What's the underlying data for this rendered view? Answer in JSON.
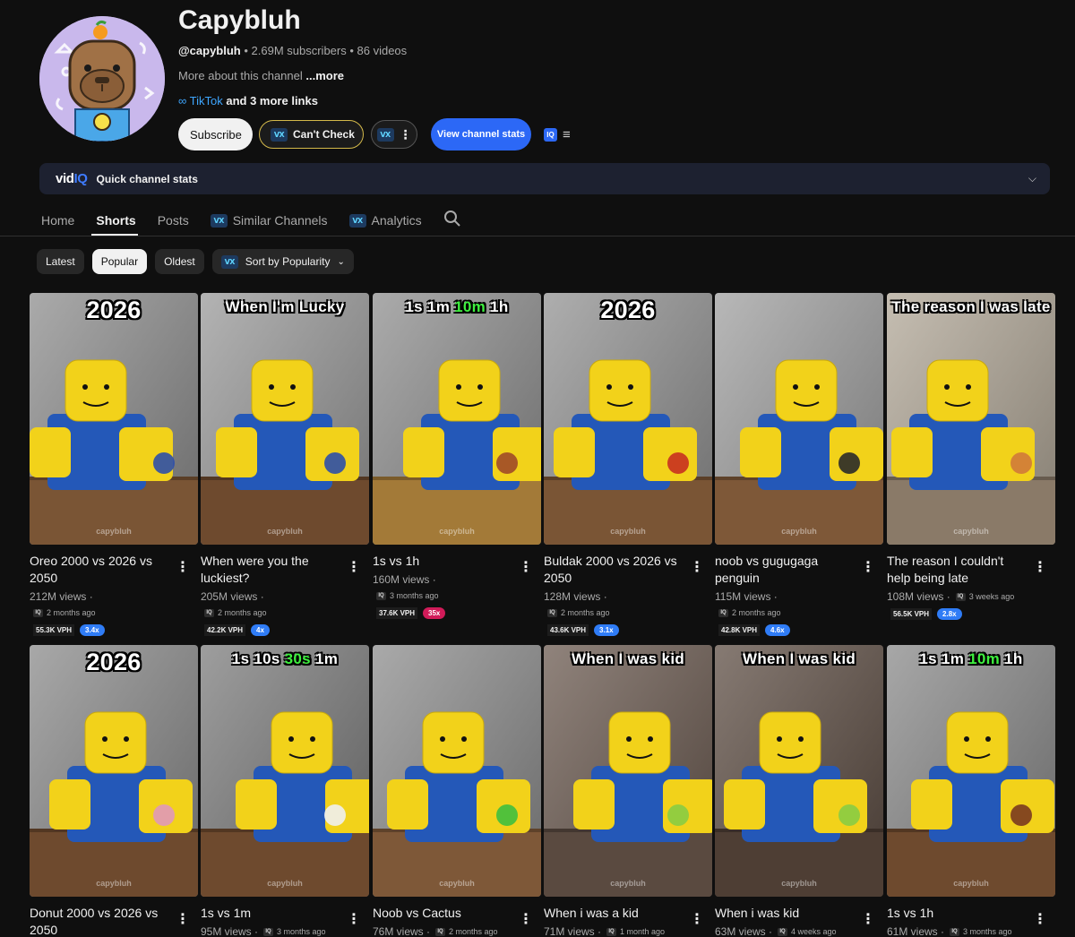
{
  "channel": {
    "name": "Capybluh",
    "handle": "@capybluh",
    "meta": " • 2.69M subscribers • 86 videos",
    "about": "More about this channel ",
    "about_more": "...more",
    "link_label": "TikTok",
    "link_rest": " and 3 more links"
  },
  "buttons": {
    "subscribe": "Subscribe",
    "cant_check": "Can't Check",
    "view_stats": "View channel stats",
    "iq": "IQ"
  },
  "quick_stats": {
    "logo_vid": "vid",
    "logo_iq": "IQ",
    "label": "Quick channel stats"
  },
  "tabs": [
    "Home",
    "Shorts",
    "Posts",
    "Similar Channels",
    "Analytics"
  ],
  "filters": [
    "Latest",
    "Popular",
    "Oldest"
  ],
  "sort_label": "Sort by Popularity",
  "videos": [
    {
      "overlay": "2026",
      "title": "Oreo 2000 vs 2026 vs 2050",
      "views": "212M views ·",
      "ago": "2 months ago",
      "vph": "55.3K VPH",
      "mult": "3.4x",
      "mult_color": "#2f7cf6"
    },
    {
      "overlay": "When I'm Lucky",
      "title": "When were you the luckiest?",
      "views": "205M views ·",
      "ago": "2 months ago",
      "vph": "42.2K VPH",
      "mult": "4x",
      "mult_color": "#2f7cf6"
    },
    {
      "overlay": "1s  1m  10m  1h",
      "title": "1s vs 1h",
      "views": "160M views ·",
      "ago": "3 months ago",
      "vph": "37.6K VPH",
      "mult": "35x",
      "mult_color": "#d11b59"
    },
    {
      "overlay": "2026",
      "title": "Buldak 2000 vs 2026 vs 2050",
      "views": "128M views ·",
      "ago": "2 months ago",
      "vph": "43.6K VPH",
      "mult": "3.1x",
      "mult_color": "#2f7cf6"
    },
    {
      "overlay": "",
      "title": "noob vs gugugaga penguin",
      "views": "115M views ·",
      "ago": "2 months ago",
      "vph": "42.8K VPH",
      "mult": "4.6x",
      "mult_color": "#2f7cf6"
    },
    {
      "overlay": "The reason I was late",
      "title": "The reason I couldn't help being late",
      "views": "108M views ·",
      "ago": "3 weeks ago",
      "vph": "56.5K VPH",
      "mult": "2.8x",
      "mult_color": "#2f7cf6"
    },
    {
      "overlay": "2026",
      "title": "Donut 2000 vs 2026 vs 2050",
      "views": "",
      "ago": "",
      "vph": "",
      "mult": "",
      "mult_color": "#2f7cf6"
    },
    {
      "overlay": "1s  10s  30s  1m",
      "title": "1s vs 1m",
      "views": "95M views ·",
      "ago": "3 months ago",
      "vph": "",
      "mult": "",
      "mult_color": "#2f7cf6"
    },
    {
      "overlay": "",
      "title": "Noob vs Cactus",
      "views": "76M views ·",
      "ago": "2 months ago",
      "vph": "",
      "mult": "",
      "mult_color": "#2f7cf6"
    },
    {
      "overlay": "When I was kid",
      "title": "When i was a kid",
      "views": "71M views ·",
      "ago": "1 month ago",
      "vph": "",
      "mult": "",
      "mult_color": "#2f7cf6"
    },
    {
      "overlay": "When I was kid",
      "title": "When i was kid",
      "views": "63M views ·",
      "ago": "4 weeks ago",
      "vph": "",
      "mult": "",
      "mult_color": "#2f7cf6"
    },
    {
      "overlay": "1s  1m  10m  1h",
      "title": "1s vs 1h",
      "views": "61M views ·",
      "ago": "3 months ago",
      "vph": "",
      "mult": "",
      "mult_color": "#2f7cf6"
    }
  ],
  "watermark": "capybluh",
  "colors": {
    "accent_blue": "#2c68f6",
    "link_blue": "#3ea6ff",
    "background": "#0f0f0f",
    "gold_border": "#d4b94a",
    "highlight_green": "#3ef03e"
  }
}
